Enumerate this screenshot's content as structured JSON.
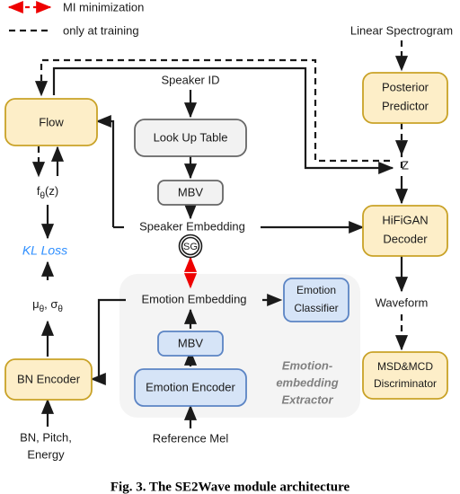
{
  "figure": {
    "caption": "Fig. 3. The SE2Wave module architecture"
  },
  "legend": {
    "items": [
      {
        "label": "MI minimization",
        "style": "red-dashed-double-arrow",
        "color": "#ee0000"
      },
      {
        "label": "only at training",
        "style": "black-dashed-line",
        "color": "#1a1a1a"
      }
    ]
  },
  "colors": {
    "yellow_fill": "#fdeec8",
    "yellow_stroke": "#c9a227",
    "blue_fill": "#d6e4f7",
    "blue_stroke": "#5b84c4",
    "gray_fill": "#f2f2f2",
    "gray_stroke": "#666666",
    "panel_fill": "#f4f4f4",
    "kl_loss_color": "#2f8fff",
    "group_caption_color": "#808080",
    "line_color": "#1a1a1a"
  },
  "blocks": [
    {
      "id": "flow",
      "label": "Flow",
      "style": "yellow"
    },
    {
      "id": "look-up-table",
      "label": "Look Up Table",
      "style": "gray"
    },
    {
      "id": "speaker-mbv",
      "label": "MBV",
      "style": "gray"
    },
    {
      "id": "posterior-predictor",
      "label": "Posterior\nPredictor",
      "line1": "Posterior",
      "line2": "Predictor",
      "style": "yellow"
    },
    {
      "id": "hifigan-decoder",
      "label": "HiFiGAN\nDecoder",
      "line1": "HiFiGAN",
      "line2": "Decoder",
      "style": "yellow"
    },
    {
      "id": "bn-encoder",
      "label": "BN Encoder",
      "style": "yellow"
    },
    {
      "id": "emotion-encoder",
      "label": "Emotion Encoder",
      "style": "blue"
    },
    {
      "id": "emotion-mbv",
      "label": "MBV",
      "style": "blue"
    },
    {
      "id": "emotion-classifier",
      "label": "Emotion\nClassifier",
      "line1": "Emotion",
      "line2": "Classifier",
      "style": "blue"
    },
    {
      "id": "discriminator",
      "label": "MSD&MCD\nDiscriminator",
      "line1": "MSD&MCD",
      "line2": "Discriminator",
      "style": "yellow"
    }
  ],
  "labels": {
    "speaker_id": "Speaker ID",
    "speaker_embedding": "Speaker Embedding",
    "emotion_embedding": "Emotion Embedding",
    "linear_spectrogram": "Linear Spectrogram",
    "z": "Z",
    "waveform": "Waveform",
    "reference_mel": "Reference Mel",
    "bn_pitch_energy_line1": "BN, Pitch,",
    "bn_pitch_energy_line2": "Energy",
    "f_theta_z": "f",
    "f_theta_z_sub": "θ",
    "f_theta_z_tail": "(z)",
    "kl_loss": "KL Loss",
    "mu_sigma": "μ",
    "mu_sigma_sub1": "θ",
    "mu_sigma_mid": ", σ",
    "mu_sigma_sub2": "θ",
    "stop_gradient": "SG",
    "group_caption_line1": "Emotion-",
    "group_caption_line2": "embedding",
    "group_caption_line3": "Extractor"
  }
}
